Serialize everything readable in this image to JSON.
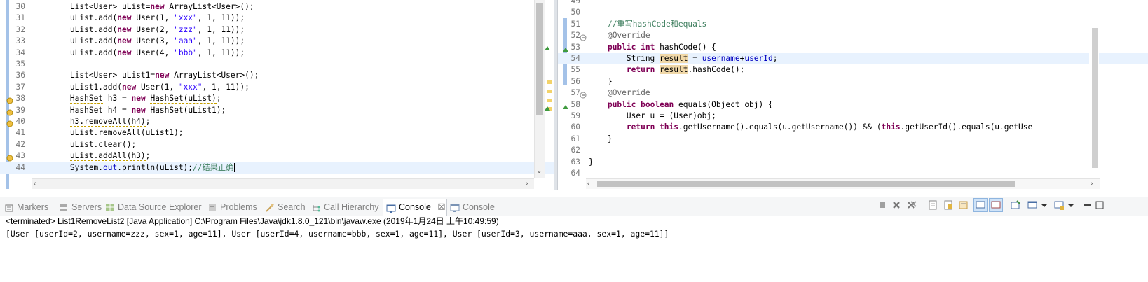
{
  "left_editor": {
    "lines": [
      {
        "num": "30",
        "code": [
          [
            "plain",
            "        List<User> uList="
          ],
          [
            "kw",
            "new"
          ],
          [
            "plain",
            " ArrayList<User>();"
          ]
        ]
      },
      {
        "num": "31",
        "code": [
          [
            "plain",
            "        uList.add("
          ],
          [
            "kw",
            "new"
          ],
          [
            "plain",
            " User(1, "
          ],
          [
            "str",
            "\"xxx\""
          ],
          [
            "plain",
            ", 1, 11));"
          ]
        ]
      },
      {
        "num": "32",
        "code": [
          [
            "plain",
            "        uList.add("
          ],
          [
            "kw",
            "new"
          ],
          [
            "plain",
            " User(2, "
          ],
          [
            "str",
            "\"zzz\""
          ],
          [
            "plain",
            ", 1, 11));"
          ]
        ]
      },
      {
        "num": "33",
        "code": [
          [
            "plain",
            "        uList.add("
          ],
          [
            "kw",
            "new"
          ],
          [
            "plain",
            " User(3, "
          ],
          [
            "str",
            "\"aaa\""
          ],
          [
            "plain",
            ", 1, 11));"
          ]
        ]
      },
      {
        "num": "34",
        "code": [
          [
            "plain",
            "        uList.add("
          ],
          [
            "kw",
            "new"
          ],
          [
            "plain",
            " User(4, "
          ],
          [
            "str",
            "\"bbb\""
          ],
          [
            "plain",
            ", 1, 11));"
          ]
        ]
      },
      {
        "num": "35",
        "code": []
      },
      {
        "num": "36",
        "code": [
          [
            "plain",
            "        List<User> uList1="
          ],
          [
            "kw",
            "new"
          ],
          [
            "plain",
            " ArrayList<User>();"
          ]
        ]
      },
      {
        "num": "37",
        "code": [
          [
            "plain",
            "        uList1.add("
          ],
          [
            "kw",
            "new"
          ],
          [
            "plain",
            " User(1, "
          ],
          [
            "str",
            "\"xxx\""
          ],
          [
            "plain",
            ", 1, 11));"
          ]
        ]
      },
      {
        "num": "38",
        "code": [
          [
            "plain",
            "        "
          ],
          [
            "warn",
            "HashSet"
          ],
          [
            "plain",
            " h3 = "
          ],
          [
            "kw",
            "new"
          ],
          [
            "plain",
            " "
          ],
          [
            "warn",
            "HashSet(uList)"
          ],
          [
            "plain",
            ";"
          ]
        ]
      },
      {
        "num": "39",
        "code": [
          [
            "plain",
            "        "
          ],
          [
            "warn",
            "HashSet"
          ],
          [
            "plain",
            " h4 = "
          ],
          [
            "kw",
            "new"
          ],
          [
            "plain",
            " "
          ],
          [
            "warn",
            "HashSet(uList1)"
          ],
          [
            "plain",
            ";"
          ]
        ]
      },
      {
        "num": "40",
        "code": [
          [
            "plain",
            "        "
          ],
          [
            "warn",
            "h3.removeAll(h4)"
          ],
          [
            "plain",
            ";"
          ]
        ]
      },
      {
        "num": "41",
        "code": [
          [
            "plain",
            "        uList.removeAll(uList1);"
          ]
        ]
      },
      {
        "num": "42",
        "code": [
          [
            "plain",
            "        uList.clear();"
          ]
        ]
      },
      {
        "num": "43",
        "code": [
          [
            "plain",
            "        "
          ],
          [
            "warn",
            "uList.addAll(h3)"
          ],
          [
            "plain",
            ";"
          ]
        ]
      },
      {
        "num": "44",
        "code": [
          [
            "plain",
            "        System."
          ],
          [
            "fld",
            "out"
          ],
          [
            "plain",
            ".println(uList);"
          ],
          [
            "cmt",
            "//结果正确"
          ]
        ]
      }
    ]
  },
  "right_editor": {
    "lines": [
      {
        "num": "49",
        "code": []
      },
      {
        "num": "50",
        "code": []
      },
      {
        "num": "51",
        "code": [
          [
            "plain",
            "    "
          ],
          [
            "cmt",
            "//重写hashCode和equals"
          ]
        ]
      },
      {
        "num": "52",
        "code": [
          [
            "plain",
            "    "
          ],
          [
            "ann",
            "@Override"
          ]
        ]
      },
      {
        "num": "53",
        "code": [
          [
            "plain",
            "    "
          ],
          [
            "kw",
            "public"
          ],
          [
            "plain",
            " "
          ],
          [
            "kw",
            "int"
          ],
          [
            "plain",
            " hashCode() {"
          ]
        ]
      },
      {
        "num": "54",
        "code": [
          [
            "plain",
            "        String "
          ],
          [
            "hl",
            "result"
          ],
          [
            "plain",
            " = "
          ],
          [
            "fld",
            "username"
          ],
          [
            "plain",
            "+"
          ],
          [
            "fld",
            "userId"
          ],
          [
            "plain",
            ";"
          ]
        ]
      },
      {
        "num": "55",
        "code": [
          [
            "plain",
            "        "
          ],
          [
            "kw",
            "return"
          ],
          [
            "plain",
            " "
          ],
          [
            "hl",
            "result"
          ],
          [
            "plain",
            ".hashCode();"
          ]
        ]
      },
      {
        "num": "56",
        "code": [
          [
            "plain",
            "    }"
          ]
        ]
      },
      {
        "num": "57",
        "code": [
          [
            "plain",
            "    "
          ],
          [
            "ann",
            "@Override"
          ]
        ]
      },
      {
        "num": "58",
        "code": [
          [
            "plain",
            "    "
          ],
          [
            "kw",
            "public"
          ],
          [
            "plain",
            " "
          ],
          [
            "kw",
            "boolean"
          ],
          [
            "plain",
            " equals(Object obj) {"
          ]
        ]
      },
      {
        "num": "59",
        "code": [
          [
            "plain",
            "        User u = (User)obj;"
          ]
        ]
      },
      {
        "num": "60",
        "code": [
          [
            "plain",
            "        "
          ],
          [
            "kw",
            "return"
          ],
          [
            "plain",
            " "
          ],
          [
            "kw",
            "this"
          ],
          [
            "plain",
            ".getUsername().equals(u.getUsername()) && ("
          ],
          [
            "kw",
            "this"
          ],
          [
            "plain",
            ".getUserId().equals(u.getUse"
          ]
        ]
      },
      {
        "num": "61",
        "code": [
          [
            "plain",
            "    }"
          ]
        ]
      },
      {
        "num": "62",
        "code": []
      },
      {
        "num": "63",
        "code": [
          [
            "plain",
            "}"
          ]
        ]
      },
      {
        "num": "64",
        "code": []
      }
    ]
  },
  "tabs": [
    {
      "label": "Markers",
      "icon": "markers-icon"
    },
    {
      "label": "Servers",
      "icon": "servers-icon"
    },
    {
      "label": "Data Source Explorer",
      "icon": "data-source-icon"
    },
    {
      "label": "Problems",
      "icon": "problems-icon"
    },
    {
      "label": "Search",
      "icon": "search-icon"
    },
    {
      "label": "Call Hierarchy",
      "icon": "call-hierarchy-icon"
    },
    {
      "label": "Console",
      "icon": "console-icon",
      "active": true,
      "close": "☒"
    },
    {
      "label": "Console",
      "icon": "console-icon"
    }
  ],
  "console": {
    "header": "<terminated> List1RemoveList2 [Java Application] C:\\Program Files\\Java\\jdk1.8.0_121\\bin\\javaw.exe (2019年1月24日 上午10:49:59)",
    "output": "[User [userId=2, username=zzz, sex=1, age=11], User [userId=4, username=bbb, sex=1, age=11], User [userId=3, username=aaa, sex=1, age=11]]"
  },
  "colors": {
    "keyword": "#7f0055",
    "string": "#2a00ff",
    "comment": "#3f7f5f",
    "current_line": "#e8f2fe"
  }
}
